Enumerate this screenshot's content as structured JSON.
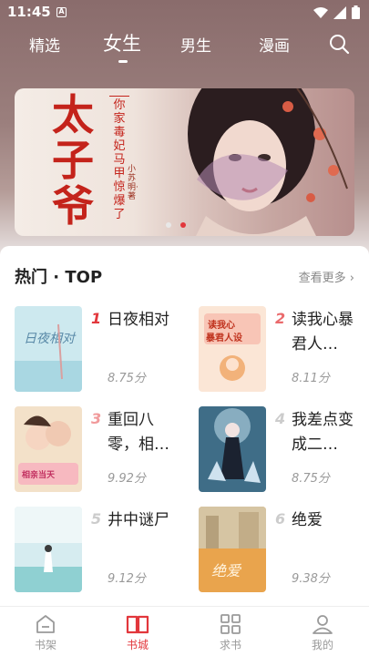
{
  "status": {
    "time": "11:45",
    "a_icon": "A"
  },
  "nav": {
    "tabs": [
      {
        "label": "精选"
      },
      {
        "label": "女生"
      },
      {
        "label": "男生"
      },
      {
        "label": "漫画"
      }
    ],
    "active_tab": "女生"
  },
  "banner": {
    "title_chars": [
      "太",
      "子",
      "爷"
    ],
    "subtitle_chars": [
      "你",
      "家",
      "毒",
      "妃",
      "马",
      "甲",
      "惊",
      "爆",
      "了"
    ],
    "author": "小苏明·著",
    "slide_count": 2,
    "active_slide": 2
  },
  "hot": {
    "title": "热门 · TOP",
    "more": "查看更多",
    "books": [
      {
        "rank": "1",
        "title": "日夜相对",
        "score": "8.75分",
        "rank_color": "#e2373c"
      },
      {
        "rank": "2",
        "title": "读我心暴君人…",
        "score": "8.11分",
        "rank_color": "#ea6a6c"
      },
      {
        "rank": "3",
        "title": "重回八零，相…",
        "score": "9.92分",
        "rank_color": "#f19a9b"
      },
      {
        "rank": "4",
        "title": "我差点变成二…",
        "score": "8.75分",
        "rank_color": "#cccccc"
      },
      {
        "rank": "5",
        "title": "井中谜尸",
        "score": "9.12分",
        "rank_color": "#cccccc"
      },
      {
        "rank": "6",
        "title": "绝爱",
        "score": "9.38分",
        "rank_color": "#cccccc"
      }
    ]
  },
  "bottom_nav": {
    "items": [
      {
        "label": "书架",
        "icon": "bookshelf-icon"
      },
      {
        "label": "书城",
        "icon": "open-book-icon"
      },
      {
        "label": "求书",
        "icon": "grid-icon"
      },
      {
        "label": "我的",
        "icon": "person-icon"
      }
    ],
    "active": "书城"
  },
  "colors": {
    "accent": "#e2373c",
    "header": "#8a6c6c"
  }
}
